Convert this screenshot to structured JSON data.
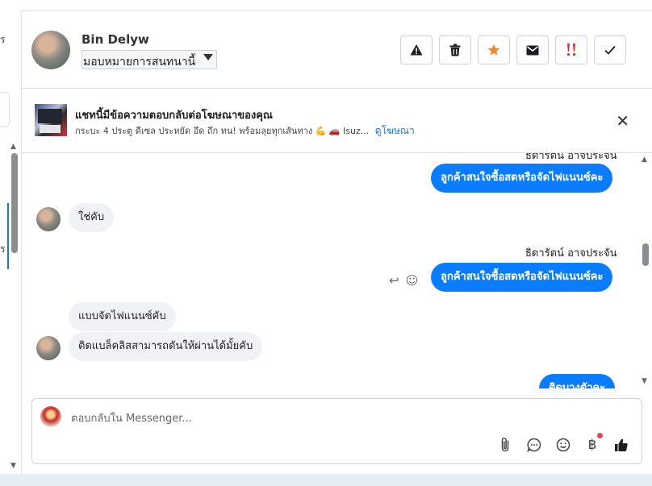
{
  "left_panel": {
    "fragment_top": "ร",
    "fragment_mid": "ร"
  },
  "header": {
    "contact_name": "Bin Delyw",
    "assign_label": "มอบหมายการสนทนานี้",
    "buttons": [
      "mark-spam",
      "delete",
      "star",
      "mark-unread",
      "important",
      "done"
    ]
  },
  "ad_banner": {
    "title": "แชทนี้มีข้อความตอบกลับต่อโฆษณาของคุณ",
    "subtitle": "กระบะ 4 ประตู ดีเซล ประหยัด อึด ถึก ทน! พร้อมลุยทุกเส้นทาง 💪 🚗 Isuz...",
    "link": "ดูโฆษณา"
  },
  "messages": {
    "top_partial_sender": "ธิดารัตน์ อาจประจัน",
    "msg1_out": "ลูกค้าสนใจซื้อสดหรือจัดไฟแนนซ์คะ",
    "msg2_in": "ใช่คับ",
    "msg3_sender": "ธิดารัตน์ อาจประจัน",
    "msg3_out": "ลูกค้าสนใจซื้อสดหรือจัดไฟแนนซ์คะ",
    "msg4_in": "แบบจัดไฟแนนซ์คับ",
    "msg5_in": "ติดแบล็คลิสสามารถดันให้ผ่านได้มั้ยคับ",
    "msg6_out_partial": "ติดบางตัวคะ"
  },
  "composer": {
    "placeholder": "ตอบกลับใน Messenger..."
  },
  "colors": {
    "accent": "#0a7cff",
    "star": "#f28b30",
    "important": "#e02d2d"
  }
}
